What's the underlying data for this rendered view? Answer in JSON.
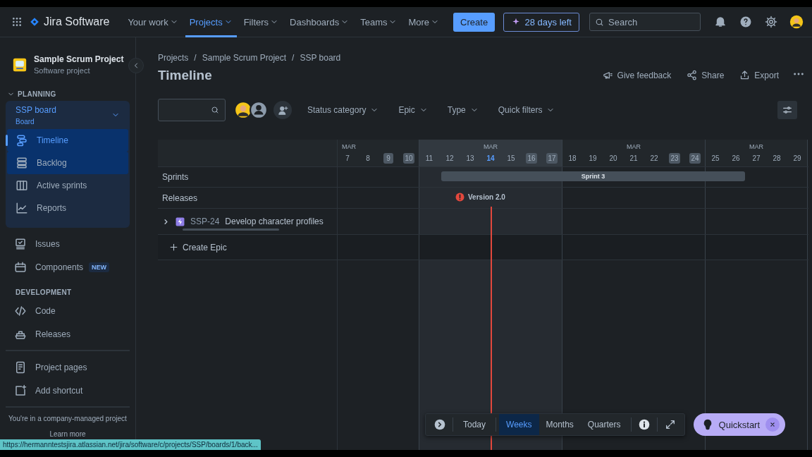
{
  "nav": {
    "product": "Jira Software",
    "menus": [
      {
        "label": "Your work",
        "selected": false
      },
      {
        "label": "Projects",
        "selected": true
      },
      {
        "label": "Filters",
        "selected": false
      },
      {
        "label": "Dashboards",
        "selected": false
      },
      {
        "label": "Teams",
        "selected": false
      },
      {
        "label": "More",
        "selected": false
      }
    ],
    "create": "Create",
    "trial": "28 days left",
    "search": {
      "placeholder": "Search"
    }
  },
  "sidebar": {
    "project": {
      "name": "Sample Scrum Project",
      "type": "Software project"
    },
    "planning": {
      "heading": "PLANNING",
      "expanded": true,
      "board": {
        "name": "SSP board",
        "type": "Board"
      },
      "items": [
        {
          "label": "Timeline",
          "selected": true,
          "hovered": false
        },
        {
          "label": "Backlog",
          "selected": false,
          "hovered": true
        },
        {
          "label": "Active sprints",
          "selected": false,
          "hovered": false
        },
        {
          "label": "Reports",
          "selected": false,
          "hovered": false
        }
      ]
    },
    "items": [
      {
        "label": "Issues"
      },
      {
        "label": "Components",
        "badge": "NEW"
      }
    ],
    "development": {
      "heading": "DEVELOPMENT",
      "items": [
        {
          "label": "Code"
        },
        {
          "label": "Releases"
        }
      ]
    },
    "extra": [
      {
        "label": "Project pages"
      },
      {
        "label": "Add shortcut"
      }
    ],
    "footer": {
      "text": "You're in a company-managed project",
      "link": "Learn more"
    }
  },
  "main": {
    "breadcrumbs": [
      "Projects",
      "Sample Scrum Project",
      "SSP board"
    ],
    "breadcrumb_separators": [
      "/",
      "/"
    ],
    "title": "Timeline",
    "actions": [
      "Give feedback",
      "Share",
      "Export"
    ],
    "filters": [
      "Status category",
      "Epic",
      "Type",
      "Quick filters"
    ]
  },
  "timeline": {
    "weeks": [
      {
        "month": "MAR",
        "current": false,
        "days": [
          {
            "label": "7",
            "weekend": false,
            "today": false
          },
          {
            "label": "8",
            "weekend": false,
            "today": false
          },
          {
            "label": "9",
            "weekend": true,
            "today": false
          },
          {
            "label": "10",
            "weekend": true,
            "today": false
          }
        ]
      },
      {
        "month": "MAR",
        "current": true,
        "days": [
          {
            "label": "11",
            "weekend": false,
            "today": false
          },
          {
            "label": "12",
            "weekend": false,
            "today": false
          },
          {
            "label": "13",
            "weekend": false,
            "today": false
          },
          {
            "label": "14",
            "weekend": false,
            "today": true
          },
          {
            "label": "15",
            "weekend": false,
            "today": false
          },
          {
            "label": "16",
            "weekend": true,
            "today": false
          },
          {
            "label": "17",
            "weekend": true,
            "today": false
          }
        ]
      },
      {
        "month": "MAR",
        "current": false,
        "days": [
          {
            "label": "18",
            "weekend": false,
            "today": false
          },
          {
            "label": "19",
            "weekend": false,
            "today": false
          },
          {
            "label": "20",
            "weekend": false,
            "today": false
          },
          {
            "label": "21",
            "weekend": false,
            "today": false
          },
          {
            "label": "22",
            "weekend": false,
            "today": false
          },
          {
            "label": "23",
            "weekend": true,
            "today": false
          },
          {
            "label": "24",
            "weekend": true,
            "today": false
          }
        ]
      },
      {
        "month": "MAR",
        "current": false,
        "days": [
          {
            "label": "25",
            "weekend": false,
            "today": false
          },
          {
            "label": "26",
            "weekend": false,
            "today": false
          },
          {
            "label": "27",
            "weekend": false,
            "today": false
          },
          {
            "label": "28",
            "weekend": false,
            "today": false
          },
          {
            "label": "29",
            "weekend": false,
            "today": false
          }
        ]
      }
    ],
    "rows": [
      {
        "kind": "sprints",
        "label": "Sprints",
        "bar": "Sprint 3"
      },
      {
        "kind": "releases",
        "label": "Releases",
        "marker": "Version 2.0"
      },
      {
        "kind": "epic",
        "key": "SSP-24",
        "summary": "Develop character profiles",
        "expanded": false,
        "level": 0
      },
      {
        "kind": "create",
        "label": "Create Epic"
      }
    ]
  },
  "zoom": {
    "today": "Today",
    "scales": [
      {
        "label": "Weeks",
        "selected": true
      },
      {
        "label": "Months",
        "selected": false
      },
      {
        "label": "Quarters",
        "selected": false
      }
    ]
  },
  "quickstart": {
    "label": "Quickstart"
  },
  "status_url": "https://hermanntestsjira.atlassian.net/jira/software/c/projects/SSP/boards/1/back..."
}
